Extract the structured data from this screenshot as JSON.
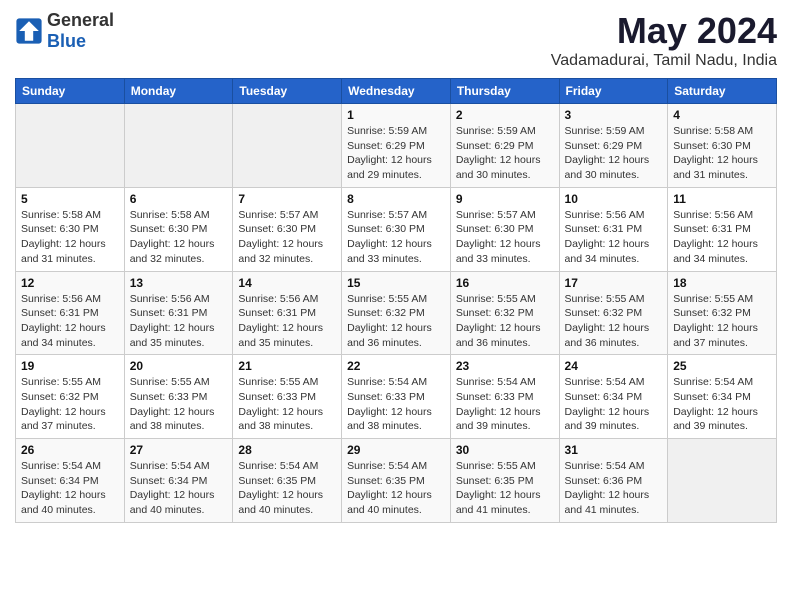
{
  "logo": {
    "general": "General",
    "blue": "Blue"
  },
  "title": "May 2024",
  "location": "Vadamadurai, Tamil Nadu, India",
  "headers": [
    "Sunday",
    "Monday",
    "Tuesday",
    "Wednesday",
    "Thursday",
    "Friday",
    "Saturday"
  ],
  "weeks": [
    [
      {
        "day": "",
        "info": ""
      },
      {
        "day": "",
        "info": ""
      },
      {
        "day": "",
        "info": ""
      },
      {
        "day": "1",
        "info": "Sunrise: 5:59 AM\nSunset: 6:29 PM\nDaylight: 12 hours\nand 29 minutes."
      },
      {
        "day": "2",
        "info": "Sunrise: 5:59 AM\nSunset: 6:29 PM\nDaylight: 12 hours\nand 30 minutes."
      },
      {
        "day": "3",
        "info": "Sunrise: 5:59 AM\nSunset: 6:29 PM\nDaylight: 12 hours\nand 30 minutes."
      },
      {
        "day": "4",
        "info": "Sunrise: 5:58 AM\nSunset: 6:30 PM\nDaylight: 12 hours\nand 31 minutes."
      }
    ],
    [
      {
        "day": "5",
        "info": "Sunrise: 5:58 AM\nSunset: 6:30 PM\nDaylight: 12 hours\nand 31 minutes."
      },
      {
        "day": "6",
        "info": "Sunrise: 5:58 AM\nSunset: 6:30 PM\nDaylight: 12 hours\nand 32 minutes."
      },
      {
        "day": "7",
        "info": "Sunrise: 5:57 AM\nSunset: 6:30 PM\nDaylight: 12 hours\nand 32 minutes."
      },
      {
        "day": "8",
        "info": "Sunrise: 5:57 AM\nSunset: 6:30 PM\nDaylight: 12 hours\nand 33 minutes."
      },
      {
        "day": "9",
        "info": "Sunrise: 5:57 AM\nSunset: 6:30 PM\nDaylight: 12 hours\nand 33 minutes."
      },
      {
        "day": "10",
        "info": "Sunrise: 5:56 AM\nSunset: 6:31 PM\nDaylight: 12 hours\nand 34 minutes."
      },
      {
        "day": "11",
        "info": "Sunrise: 5:56 AM\nSunset: 6:31 PM\nDaylight: 12 hours\nand 34 minutes."
      }
    ],
    [
      {
        "day": "12",
        "info": "Sunrise: 5:56 AM\nSunset: 6:31 PM\nDaylight: 12 hours\nand 34 minutes."
      },
      {
        "day": "13",
        "info": "Sunrise: 5:56 AM\nSunset: 6:31 PM\nDaylight: 12 hours\nand 35 minutes."
      },
      {
        "day": "14",
        "info": "Sunrise: 5:56 AM\nSunset: 6:31 PM\nDaylight: 12 hours\nand 35 minutes."
      },
      {
        "day": "15",
        "info": "Sunrise: 5:55 AM\nSunset: 6:32 PM\nDaylight: 12 hours\nand 36 minutes."
      },
      {
        "day": "16",
        "info": "Sunrise: 5:55 AM\nSunset: 6:32 PM\nDaylight: 12 hours\nand 36 minutes."
      },
      {
        "day": "17",
        "info": "Sunrise: 5:55 AM\nSunset: 6:32 PM\nDaylight: 12 hours\nand 36 minutes."
      },
      {
        "day": "18",
        "info": "Sunrise: 5:55 AM\nSunset: 6:32 PM\nDaylight: 12 hours\nand 37 minutes."
      }
    ],
    [
      {
        "day": "19",
        "info": "Sunrise: 5:55 AM\nSunset: 6:32 PM\nDaylight: 12 hours\nand 37 minutes."
      },
      {
        "day": "20",
        "info": "Sunrise: 5:55 AM\nSunset: 6:33 PM\nDaylight: 12 hours\nand 38 minutes."
      },
      {
        "day": "21",
        "info": "Sunrise: 5:55 AM\nSunset: 6:33 PM\nDaylight: 12 hours\nand 38 minutes."
      },
      {
        "day": "22",
        "info": "Sunrise: 5:54 AM\nSunset: 6:33 PM\nDaylight: 12 hours\nand 38 minutes."
      },
      {
        "day": "23",
        "info": "Sunrise: 5:54 AM\nSunset: 6:33 PM\nDaylight: 12 hours\nand 39 minutes."
      },
      {
        "day": "24",
        "info": "Sunrise: 5:54 AM\nSunset: 6:34 PM\nDaylight: 12 hours\nand 39 minutes."
      },
      {
        "day": "25",
        "info": "Sunrise: 5:54 AM\nSunset: 6:34 PM\nDaylight: 12 hours\nand 39 minutes."
      }
    ],
    [
      {
        "day": "26",
        "info": "Sunrise: 5:54 AM\nSunset: 6:34 PM\nDaylight: 12 hours\nand 40 minutes."
      },
      {
        "day": "27",
        "info": "Sunrise: 5:54 AM\nSunset: 6:34 PM\nDaylight: 12 hours\nand 40 minutes."
      },
      {
        "day": "28",
        "info": "Sunrise: 5:54 AM\nSunset: 6:35 PM\nDaylight: 12 hours\nand 40 minutes."
      },
      {
        "day": "29",
        "info": "Sunrise: 5:54 AM\nSunset: 6:35 PM\nDaylight: 12 hours\nand 40 minutes."
      },
      {
        "day": "30",
        "info": "Sunrise: 5:55 AM\nSunset: 6:35 PM\nDaylight: 12 hours\nand 41 minutes."
      },
      {
        "day": "31",
        "info": "Sunrise: 5:54 AM\nSunset: 6:36 PM\nDaylight: 12 hours\nand 41 minutes."
      },
      {
        "day": "",
        "info": ""
      }
    ]
  ]
}
